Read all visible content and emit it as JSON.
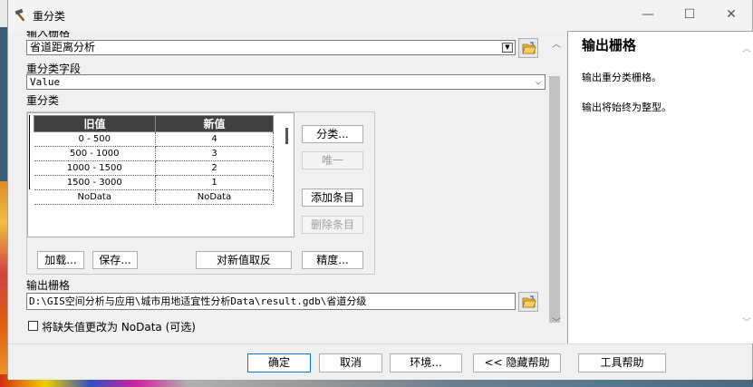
{
  "window": {
    "title": "重分类",
    "minimize": "—",
    "maximize": "☐",
    "close": "✕"
  },
  "form": {
    "input_raster_label": "输入栅格",
    "input_raster_value": "省道距离分析",
    "field_label": "重分类字段",
    "field_value": "Value",
    "reclass_label": "重分类",
    "table": {
      "headers": [
        "旧值",
        "新值"
      ],
      "rows": [
        [
          "0 - 500",
          "4"
        ],
        [
          "500 - 1000",
          "3"
        ],
        [
          "1000 - 1500",
          "2"
        ],
        [
          "1500 - 3000",
          "1"
        ],
        [
          "NoData",
          "NoData"
        ]
      ]
    },
    "buttons": {
      "classify": "分类...",
      "unique": "唯一",
      "add_entry": "添加条目",
      "delete_entry": "删除条目",
      "load": "加载...",
      "save": "保存...",
      "reverse": "对新值取反",
      "precision": "精度..."
    },
    "output_raster_label": "输出栅格",
    "output_raster_value": "D:\\GIS空间分析与应用\\城市用地适宜性分析Data\\result.gdb\\省道分级",
    "nodata_label": "将缺失值更改为 NoData (可选)"
  },
  "help": {
    "title": "输出栅格",
    "line1": "输出重分类栅格。",
    "line2": "输出将始终为整型。"
  },
  "footer": {
    "ok": "确定",
    "cancel": "取消",
    "env": "环境...",
    "hide_help": "<< 隐藏帮助",
    "tool_help": "工具帮助"
  }
}
